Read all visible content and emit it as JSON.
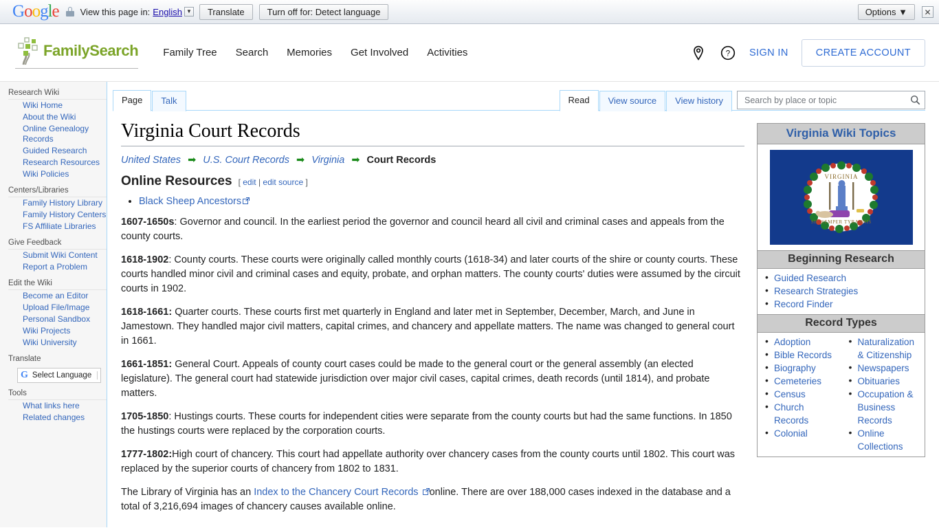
{
  "translate_bar": {
    "logo": "Google",
    "lock_icon": "lock-icon",
    "view_label": "View this page in:",
    "language": "English",
    "translate_button": "Translate",
    "turn_off_button": "Turn off for: Detect language",
    "options_button": "Options",
    "options_caret": "▼",
    "close_icon": "✕"
  },
  "header": {
    "brand": "FamilySearch",
    "nav": [
      {
        "label": "Family Tree"
      },
      {
        "label": "Search"
      },
      {
        "label": "Memories"
      },
      {
        "label": "Get Involved"
      },
      {
        "label": "Activities"
      }
    ],
    "location_icon": "map-pin-icon",
    "help_icon": "help-circle-icon",
    "sign_in": "SIGN IN",
    "create_account": "CREATE ACCOUNT",
    "brand_color": "#7ba428",
    "link_color": "#2d6ad3"
  },
  "sidebar": {
    "groups": [
      {
        "heading": "Research Wiki",
        "items": [
          {
            "label": "Wiki Home"
          },
          {
            "label": "About the Wiki"
          },
          {
            "label": "Online Genealogy Records"
          },
          {
            "label": "Guided Research"
          },
          {
            "label": "Research Resources"
          },
          {
            "label": "Wiki Policies"
          }
        ]
      },
      {
        "heading": "Centers/Libraries",
        "items": [
          {
            "label": "Family History Library"
          },
          {
            "label": "Family History Centers"
          },
          {
            "label": "FS Affiliate Libraries"
          }
        ]
      },
      {
        "heading": "Give Feedback",
        "items": [
          {
            "label": "Submit Wiki Content"
          },
          {
            "label": "Report a Problem"
          }
        ]
      },
      {
        "heading": "Edit the Wiki",
        "items": [
          {
            "label": "Become an Editor"
          },
          {
            "label": "Upload File/Image"
          },
          {
            "label": "Personal Sandbox"
          },
          {
            "label": "Wiki Projects"
          },
          {
            "label": "Wiki University"
          }
        ]
      }
    ],
    "translate_heading": "Translate",
    "select_language": "Select Language",
    "tools_heading": "Tools",
    "tools_items": [
      {
        "label": "What links here"
      },
      {
        "label": "Related changes"
      }
    ]
  },
  "tabs": {
    "left": [
      {
        "label": "Page",
        "active": true
      },
      {
        "label": "Talk",
        "active": false
      }
    ],
    "right": [
      {
        "label": "Read",
        "active": true
      },
      {
        "label": "View source",
        "active": false
      },
      {
        "label": "View history",
        "active": false
      }
    ],
    "search_placeholder": "Search by place or topic",
    "search_value": "",
    "search_icon": "search-icon"
  },
  "article": {
    "title": "Virginia Court Records",
    "breadcrumb": [
      {
        "label": "United States",
        "link": true
      },
      {
        "label": "U.S. Court Records",
        "link": true
      },
      {
        "label": "Virginia",
        "link": true
      },
      {
        "label": "Court Records",
        "link": false
      }
    ],
    "arrow": "➡",
    "section_heading": "Online Resources",
    "edit_open": "[",
    "edit_label": "edit",
    "edit_sep": "|",
    "edit_source_label": "edit source",
    "edit_close": "]",
    "resource_links": [
      {
        "label": "Black Sheep Ancestors"
      }
    ],
    "paragraphs": [
      {
        "bold": "1607-1650s",
        "text": ": Governor and council. In the earliest period the governor and council heard all civil and criminal cases and appeals from the county courts."
      },
      {
        "bold": "1618-1902",
        "text": ": County courts. These courts were originally called monthly courts (1618-34) and later courts of the shire or county courts. These courts handled minor civil and criminal cases and equity, probate, and orphan matters. The county courts' duties were assumed by the circuit courts in 1902."
      },
      {
        "bold": "1618-1661:",
        "text": " Quarter courts. These courts first met quarterly in England and later met in September, December, March, and June in Jamestown. They handled major civil matters, capital crimes, and chancery and appellate matters. The name was changed to general court in 1661."
      },
      {
        "bold": "1661-1851:",
        "text": " General Court. Appeals of county court cases could be made to the general court or the general assembly (an elected legislature). The general court had statewide jurisdiction over major civil cases, capital crimes, death records (until 1814), and probate matters."
      },
      {
        "bold": "1705-1850",
        "text": ": Hustings courts. These courts for independent cities were separate from the county courts but had the same functions. In 1850 the hustings courts were replaced by the corporation courts."
      },
      {
        "bold": "1777-1802:",
        "text": "High court of chancery. This court had appellate authority over chancery cases from the county courts until 1802. This court was replaced by the superior courts of chancery from 1802 to 1831."
      }
    ],
    "last_paragraph": {
      "pre": "The Library of Virginia has an ",
      "link": "Index to the Chancery Court Records ",
      "post": "online. There are over 188,000 cases indexed in the database and a total of 3,216,694 images of chancery causes available online."
    }
  },
  "infobox": {
    "title": "Virginia Wiki Topics",
    "flag_alt": "virginia-state-flag",
    "flag_colors": {
      "field": "#133a8c",
      "seal_ring": "#ffffff",
      "wreath": "#1e7a2e",
      "berries": "#c0392b"
    },
    "sections": [
      {
        "heading": "Beginning Research",
        "items": [
          {
            "label": "Guided Research"
          },
          {
            "label": "Research Strategies"
          },
          {
            "label": "Record Finder"
          }
        ]
      }
    ],
    "record_types_heading": "Record Types",
    "record_types_col1": [
      {
        "label": "Adoption"
      },
      {
        "label": "Bible Records"
      },
      {
        "label": "Biography"
      },
      {
        "label": "Cemeteries"
      },
      {
        "label": "Census"
      },
      {
        "label": "Church Records"
      },
      {
        "label": "Colonial"
      }
    ],
    "record_types_col2": [
      {
        "label": "Naturalization & Citizenship"
      },
      {
        "label": "Newspapers"
      },
      {
        "label": "Obituaries"
      },
      {
        "label": "Occupation & Business Records"
      },
      {
        "label": "Online Collections"
      }
    ]
  }
}
